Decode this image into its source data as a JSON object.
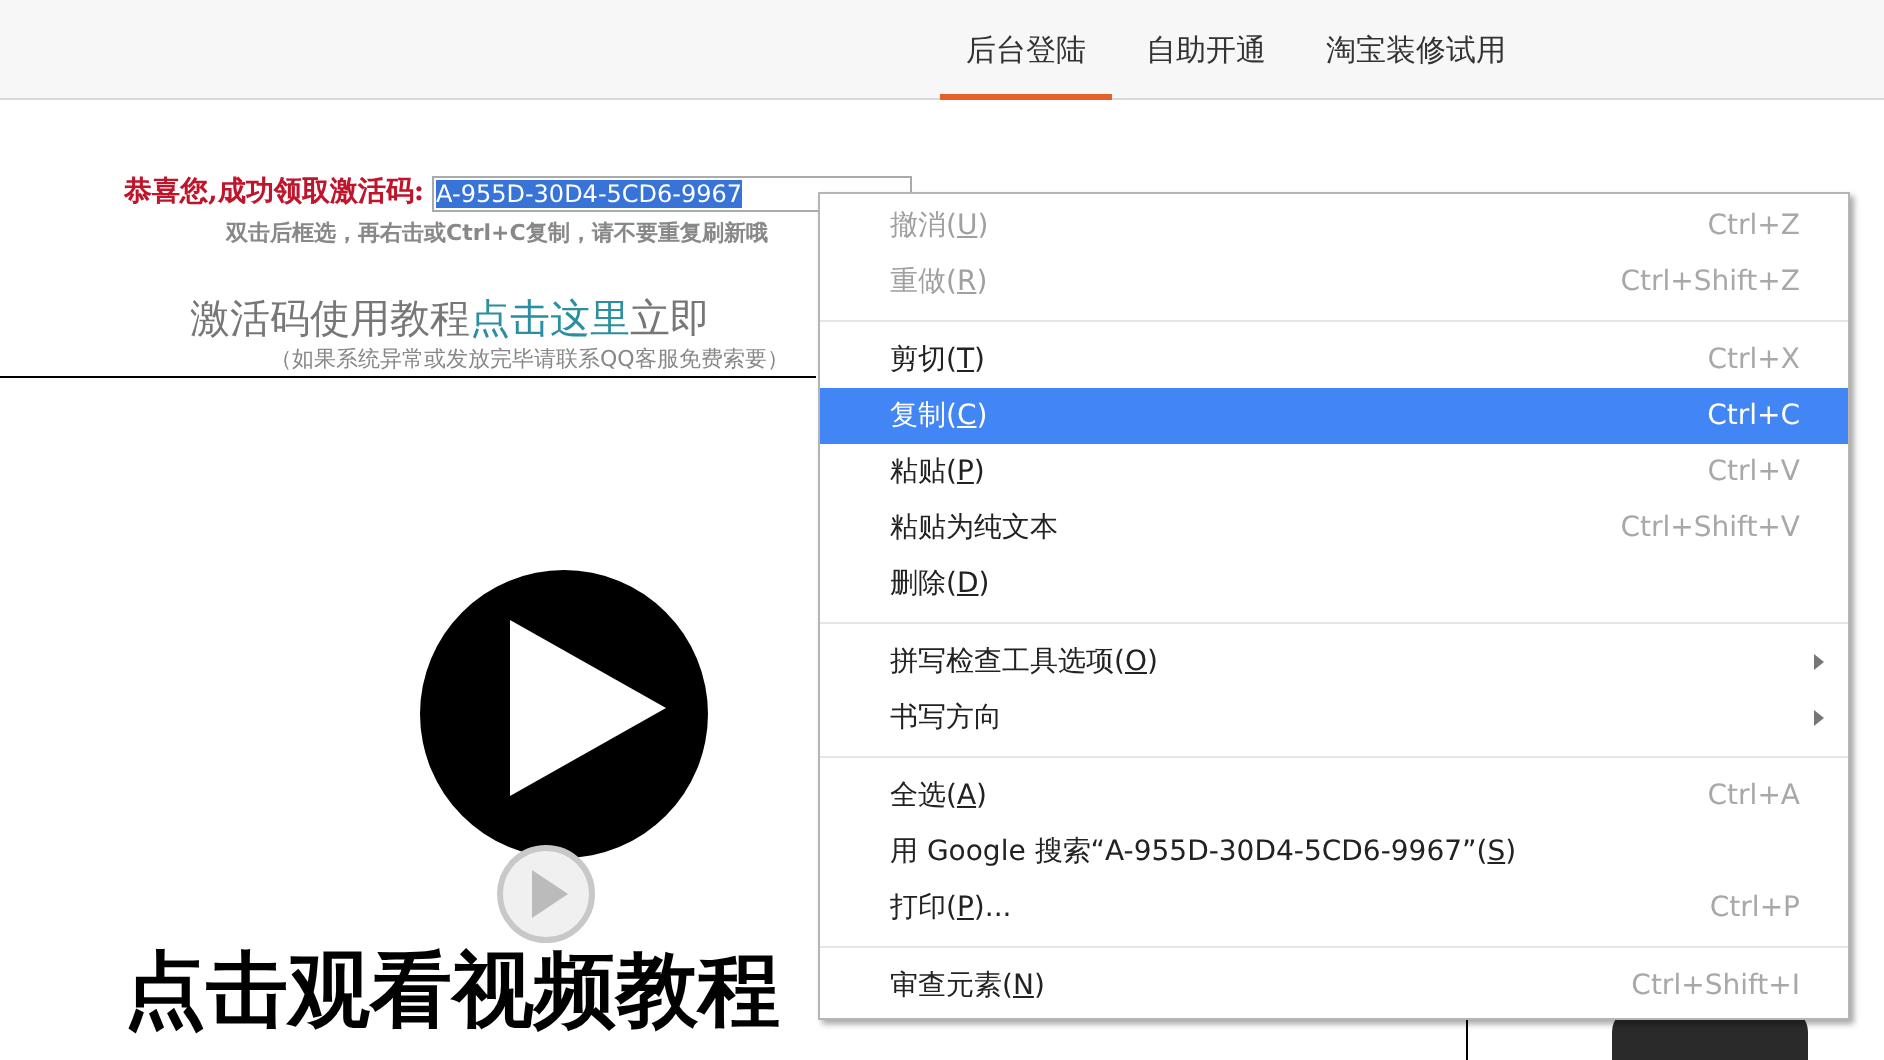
{
  "nav": {
    "tabs": [
      {
        "label": "后台登陆",
        "selected": true
      },
      {
        "label": "自助开通",
        "selected": false
      },
      {
        "label": "淘宝装修试用",
        "selected": false
      }
    ]
  },
  "notice": {
    "label": "恭喜您,成功领取激活码:",
    "code": {
      "value": "A-955D-30D4-5CD6-9967",
      "selected": true
    },
    "hint": "双击后框选，再右击或Ctrl+C复制，请不要重复刷新哦"
  },
  "tutorial": {
    "text": "激活码使用教程",
    "link": "点击这里",
    "after": "立即",
    "note": "（如果系统异常或发放完毕请联系QQ客服免费索要）"
  },
  "video": {
    "caption": "点击观看视频教程"
  },
  "context_menu": {
    "items": [
      {
        "kind": "item",
        "label": "撤消(",
        "accel": "U",
        "after": ")",
        "shortcut": "Ctrl+Z",
        "disabled": true,
        "selected": false,
        "submenu": false
      },
      {
        "kind": "item",
        "label": "重做(",
        "accel": "R",
        "after": ")",
        "shortcut": "Ctrl+Shift+Z",
        "disabled": true,
        "selected": false,
        "submenu": false
      },
      {
        "kind": "separator"
      },
      {
        "kind": "item",
        "label": "剪切(",
        "accel": "T",
        "after": ")",
        "shortcut": "Ctrl+X",
        "disabled": false,
        "selected": false,
        "submenu": false
      },
      {
        "kind": "item",
        "label": "复制(",
        "accel": "C",
        "after": ")",
        "shortcut": "Ctrl+C",
        "disabled": false,
        "selected": true,
        "submenu": false
      },
      {
        "kind": "item",
        "label": "粘贴(",
        "accel": "P",
        "after": ")",
        "shortcut": "Ctrl+V",
        "disabled": false,
        "selected": false,
        "submenu": false
      },
      {
        "kind": "item",
        "label": "粘贴为纯文本",
        "shortcut": "Ctrl+Shift+V",
        "disabled": false,
        "selected": false,
        "submenu": false
      },
      {
        "kind": "item",
        "label": "删除(",
        "accel": "D",
        "after": ")",
        "disabled": false,
        "selected": false,
        "submenu": false
      },
      {
        "kind": "separator"
      },
      {
        "kind": "item",
        "label": "拼写检查工具选项(",
        "accel": "O",
        "after": ")",
        "disabled": false,
        "selected": false,
        "submenu": true
      },
      {
        "kind": "item",
        "label": "书写方向",
        "disabled": false,
        "selected": false,
        "submenu": true
      },
      {
        "kind": "separator"
      },
      {
        "kind": "item",
        "label": "全选(",
        "accel": "A",
        "after": ")",
        "shortcut": "Ctrl+A",
        "disabled": false,
        "selected": false,
        "submenu": false
      },
      {
        "kind": "item",
        "label": "用 Google 搜索“A-955D-30D4-5CD6-9967”(",
        "accel": "S",
        "after": ")",
        "disabled": false,
        "selected": false,
        "submenu": false
      },
      {
        "kind": "item",
        "label": "打印(",
        "accel": "P",
        "after": ")...",
        "shortcut": "Ctrl+P",
        "disabled": false,
        "selected": false,
        "submenu": false
      },
      {
        "kind": "separator"
      },
      {
        "kind": "item",
        "label": "审查元素(",
        "accel": "N",
        "after": ")",
        "shortcut": "Ctrl+Shift+I",
        "disabled": false,
        "selected": false,
        "submenu": false
      }
    ]
  }
}
